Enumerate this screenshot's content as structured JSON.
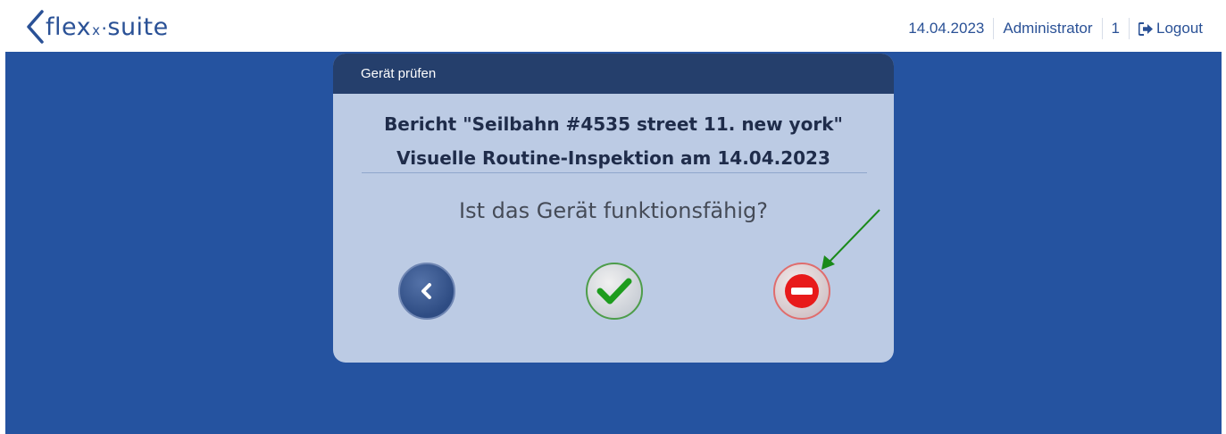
{
  "header": {
    "logo": "flex x suite",
    "date": "14.04.2023",
    "user": "Administrator",
    "count": "1",
    "logout_label": "Logout"
  },
  "dialog": {
    "header_title": "Gerät prüfen",
    "report_title": "Bericht \"Seilbahn #4535 street 11. new york\"",
    "report_subtitle": "Visuelle Routine-Inspektion am 14.04.2023",
    "question": "Ist das Gerät funktionsfähig?",
    "buttons": {
      "back_icon": "chevron-left-icon",
      "yes_icon": "checkmark-icon",
      "no_icon": "minus-circle-icon"
    }
  },
  "annotation": {
    "arrow_color": "#1a8a1a",
    "arrow_target": "no-button"
  },
  "colors": {
    "brand": "#2a5196",
    "background": "#2553a0",
    "dialog_header": "#253f6c",
    "dialog_body": "#bccbe4",
    "yes": "#1e9c1e",
    "no": "#e81a1a"
  }
}
